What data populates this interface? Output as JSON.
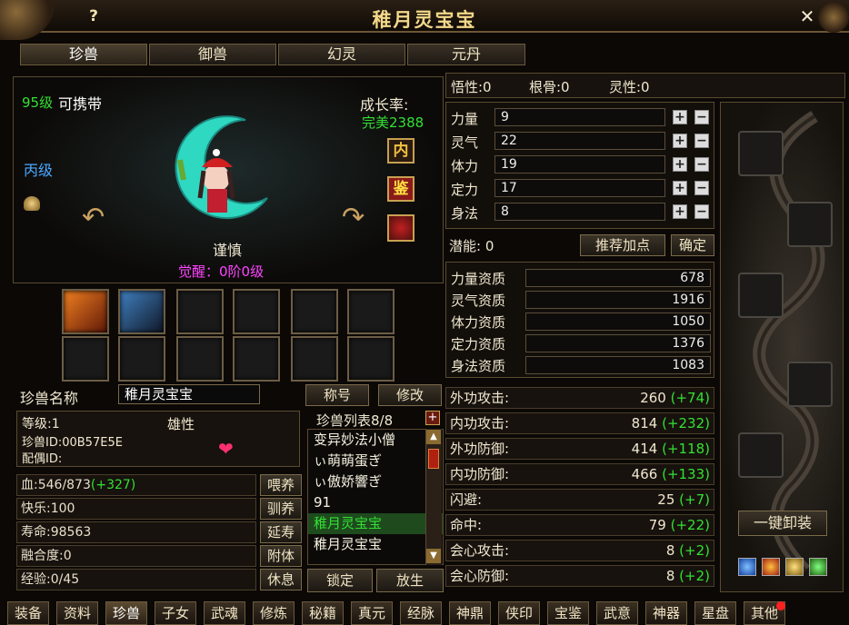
{
  "window": {
    "title": "稚月灵宝宝",
    "help": "?",
    "close": "✕"
  },
  "tabs": [
    "珍兽",
    "御兽",
    "幻灵",
    "元丹"
  ],
  "pet": {
    "level_text": "95级",
    "carry_text": "可携带",
    "grade": "丙级",
    "growth_label": "成长率:",
    "growth_value": "完美2388",
    "temper": "谨慎",
    "awaken": "觉醒：0阶0级",
    "side_buttons": [
      "内",
      "鉴"
    ]
  },
  "name_row": {
    "label": "珍兽名称",
    "value": "稚月灵宝宝",
    "title_button": "称号",
    "modify_button": "修改"
  },
  "info": {
    "level": "等级:1",
    "gender": "雄性",
    "pet_id": "珍兽ID:00B57E5E",
    "mate_id": "配偶ID:"
  },
  "status_rows": [
    {
      "label": "血:546/873",
      "bonus": "(+327)",
      "button": "喂养"
    },
    {
      "label": "快乐:100",
      "bonus": "",
      "button": "驯养"
    },
    {
      "label": "寿命:98563",
      "bonus": "",
      "button": "延寿"
    },
    {
      "label": "融合度:0",
      "bonus": "",
      "button": "附体"
    },
    {
      "label": "经验:0/45",
      "bonus": "",
      "button": "休息"
    }
  ],
  "pet_list": {
    "title": "珍兽列表8/8",
    "items": [
      "变异妙法小僧",
      "ぃ萌萌蛋ぎ",
      "ぃ傲娇響ぎ",
      "91",
      "稚月灵宝宝",
      "稚月灵宝宝"
    ],
    "selected_index": 4,
    "lock_button": "锁定",
    "release_button": "放生"
  },
  "top_stats": {
    "wuxing": "悟性:0",
    "gengu": "根骨:0",
    "lingxing": "灵性:0"
  },
  "attributes": [
    {
      "label": "力量",
      "value": "9"
    },
    {
      "label": "灵气",
      "value": "22"
    },
    {
      "label": "体力",
      "value": "19"
    },
    {
      "label": "定力",
      "value": "17"
    },
    {
      "label": "身法",
      "value": "8"
    }
  ],
  "potential": {
    "label": "潜能: 0",
    "recommend_button": "推荐加点",
    "confirm_button": "确定"
  },
  "aptitudes": [
    {
      "label": "力量资质",
      "value": "678"
    },
    {
      "label": "灵气资质",
      "value": "1916"
    },
    {
      "label": "体力资质",
      "value": "1050"
    },
    {
      "label": "定力资质",
      "value": "1376"
    },
    {
      "label": "身法资质",
      "value": "1083"
    }
  ],
  "combat": [
    {
      "label": "外功攻击:",
      "value": "260",
      "bonus": "(+74)"
    },
    {
      "label": "内功攻击:",
      "value": "814",
      "bonus": "(+232)"
    },
    {
      "label": "外功防御:",
      "value": "414",
      "bonus": "(+118)"
    },
    {
      "label": "内功防御:",
      "value": "466",
      "bonus": "(+133)"
    },
    {
      "label": "闪避:",
      "value": "25",
      "bonus": "(+7)"
    },
    {
      "label": "命中:",
      "value": "79",
      "bonus": "(+22)"
    },
    {
      "label": "会心攻击:",
      "value": "8",
      "bonus": "(+2)"
    },
    {
      "label": "会心防御:",
      "value": "8",
      "bonus": "(+2)"
    }
  ],
  "unequip_button": "一键卸装",
  "bottom_tabs": [
    "装备",
    "资料",
    "珍兽",
    "子女",
    "武魂",
    "修炼",
    "秘籍",
    "真元",
    "经脉",
    "神鼎",
    "侠印",
    "宝鉴",
    "武意",
    "神器",
    "星盘",
    "其他"
  ],
  "colors": {
    "accent_gold": "#f0d070",
    "green": "#33e033",
    "magenta": "#ff44ff",
    "title": "#f4d88a"
  }
}
